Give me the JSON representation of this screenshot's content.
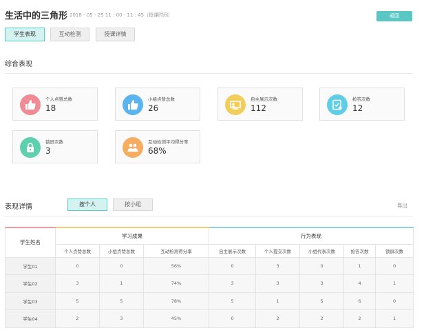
{
  "header": {
    "title": "生活中的三角形",
    "time": "2018 - 05 - 25   11 : 00 - 11 : 45（授课时间）",
    "back_label": "返回"
  },
  "tabs": [
    {
      "label": "学生表现",
      "active": true
    },
    {
      "label": "互动检测",
      "active": false
    },
    {
      "label": "授课详情",
      "active": false
    }
  ],
  "summary": {
    "title": "综合表现",
    "cards": [
      {
        "label": "个人点赞总数",
        "value": "18",
        "icon": "thumbs-up-icon",
        "color": "#f08a95"
      },
      {
        "label": "小组点赞总数",
        "value": "26",
        "icon": "thumbs-up-icon",
        "color": "#5ab4ee"
      },
      {
        "label": "自主展示次数",
        "value": "112",
        "icon": "presentation-icon",
        "color": "#f1cd5a"
      },
      {
        "label": "抢答次数",
        "value": "12",
        "icon": "answer-sheet-icon",
        "color": "#5fcde6"
      },
      {
        "label": "锁屏次数",
        "value": "3",
        "icon": "lock-icon",
        "color": "#5dd0ae"
      },
      {
        "label": "互动检测平均得分率",
        "value": "68%",
        "icon": "group-icon",
        "color": "#f6ad62"
      }
    ]
  },
  "details": {
    "title": "表现详情",
    "toggle_person": "按个人",
    "toggle_group": "按小组",
    "export_label": "导出",
    "table": {
      "name_header": "学生姓名",
      "group_learning": "学习成果",
      "group_behavior": "行为表现",
      "columns": [
        "个人点赞总数",
        "小组点赞总数",
        "互动检测得分率",
        "自主展示次数",
        "个人提交次数",
        "小组代表次数",
        "抢答次数",
        "锁屏次数"
      ],
      "rows": [
        {
          "name": "学生01",
          "cells": [
            "0",
            "0",
            "56%",
            "0",
            "3",
            "0",
            "1",
            "0"
          ]
        },
        {
          "name": "学生02",
          "cells": [
            "3",
            "1",
            "74%",
            "3",
            "3",
            "3",
            "4",
            "1"
          ]
        },
        {
          "name": "学生03",
          "cells": [
            "5",
            "5",
            "78%",
            "5",
            "1",
            "5",
            "6",
            "0"
          ]
        },
        {
          "name": "学生04",
          "cells": [
            "2",
            "3",
            "45%",
            "0",
            "2",
            "2",
            "2",
            "1"
          ]
        }
      ]
    }
  }
}
